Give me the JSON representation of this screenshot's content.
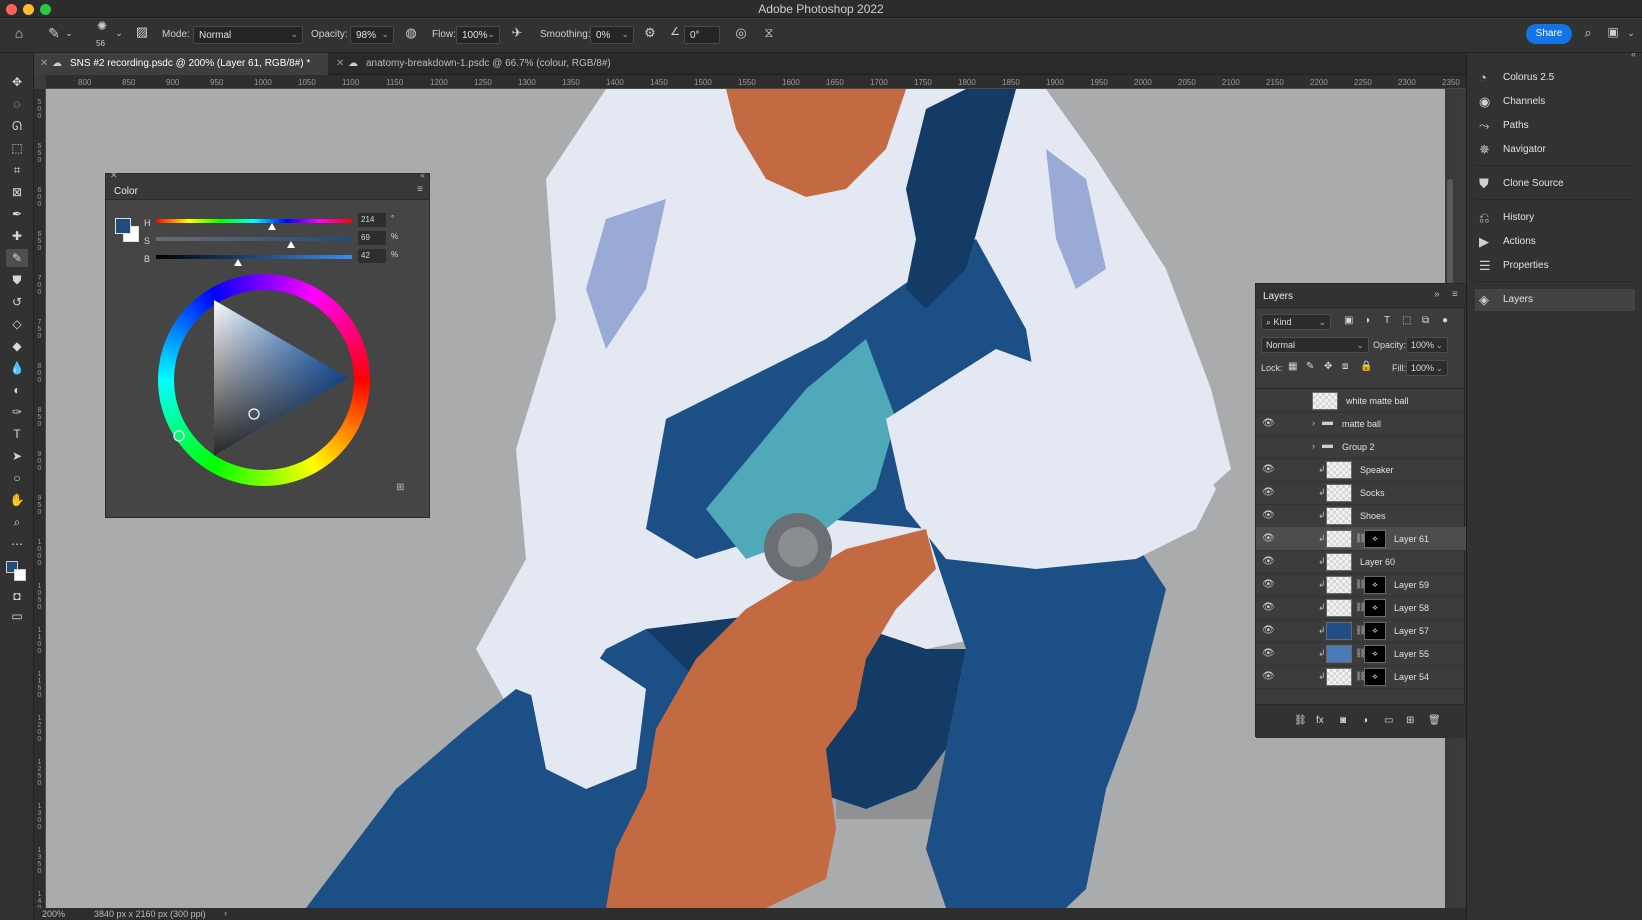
{
  "app": {
    "title": "Adobe Photoshop 2022"
  },
  "options": {
    "brush_size": "56",
    "mode_label": "Mode:",
    "mode_value": "Normal",
    "opacity_label": "Opacity:",
    "opacity_value": "98%",
    "flow_label": "Flow:",
    "flow_value": "100%",
    "smoothing_label": "Smoothing:",
    "smoothing_value": "0%",
    "angle_value": "0°",
    "share_label": "Share"
  },
  "tabs": [
    {
      "label": "SNS #2 recording.psdc @ 200% (Layer 61, RGB/8#) *",
      "active": true
    },
    {
      "label": "anatomy-breakdown-1.psdc @ 66.7% (colour, RGB/8#)",
      "active": false
    }
  ],
  "ruler": {
    "top_ticks": [
      "800",
      "850",
      "900",
      "950",
      "1000",
      "1050",
      "1100",
      "1150",
      "1200",
      "1250",
      "1300",
      "1350",
      "1400",
      "1450",
      "1500",
      "1550",
      "1600",
      "1650",
      "1700",
      "1750",
      "1800",
      "1850",
      "1900",
      "1950",
      "2000",
      "2050",
      "2100",
      "2150",
      "2200",
      "2250",
      "2300",
      "2350"
    ],
    "left_ticks": [
      "500",
      "550",
      "600",
      "650",
      "700",
      "750",
      "800",
      "850",
      "900",
      "950",
      "1000",
      "1050",
      "1100",
      "1150",
      "1200",
      "1250",
      "1300",
      "1350",
      "1400"
    ]
  },
  "status": {
    "zoom": "200%",
    "doc_info": "3840 px x 2160 px (300 ppi)"
  },
  "color_panel": {
    "title": "Color",
    "h_label": "H",
    "h_value": "214",
    "h_unit": "°",
    "h_pos": 0.59,
    "s_label": "S",
    "s_value": "69",
    "s_unit": "%",
    "s_pos": 0.69,
    "b_label": "B",
    "b_value": "42",
    "b_unit": "%",
    "b_pos": 0.42,
    "foreground_color": "#214c7b",
    "background_color": "#ffffff"
  },
  "dock": {
    "items": [
      {
        "label": "Colorus 2.5",
        "icon": "colorus-icon"
      },
      {
        "label": "Channels",
        "icon": "channels-icon"
      },
      {
        "label": "Paths",
        "icon": "paths-icon"
      },
      {
        "label": "Navigator",
        "icon": "navigator-icon"
      },
      {
        "label": "Clone Source",
        "icon": "clone-source-icon"
      },
      {
        "label": "History",
        "icon": "history-icon"
      },
      {
        "label": "Actions",
        "icon": "actions-icon"
      },
      {
        "label": "Properties",
        "icon": "properties-icon"
      },
      {
        "label": "Layers",
        "icon": "layers-icon"
      }
    ]
  },
  "layers_panel": {
    "title": "Layers",
    "filter_kind": "Kind",
    "blend_mode": "Normal",
    "opacity_label": "Opacity:",
    "opacity_value": "100%",
    "lock_label": "Lock:",
    "fill_label": "Fill:",
    "fill_value": "100%",
    "layers": [
      {
        "name": "white matte ball",
        "visible": false,
        "type": "layer"
      },
      {
        "name": "matte ball",
        "visible": true,
        "type": "group"
      },
      {
        "name": "Group 2",
        "visible": false,
        "type": "group"
      },
      {
        "name": "Speaker",
        "visible": true,
        "type": "clipped"
      },
      {
        "name": "Socks",
        "visible": true,
        "type": "clipped"
      },
      {
        "name": "Shoes",
        "visible": true,
        "type": "clipped"
      },
      {
        "name": "Layer 61",
        "visible": true,
        "type": "clipped-mask",
        "selected": true
      },
      {
        "name": "Layer 60",
        "visible": true,
        "type": "clipped"
      },
      {
        "name": "Layer 59",
        "visible": true,
        "type": "clipped-mask"
      },
      {
        "name": "Layer 58",
        "visible": true,
        "type": "clipped-mask"
      },
      {
        "name": "Layer 57",
        "visible": true,
        "type": "clipped-mask",
        "thumb": "#1f4f86"
      },
      {
        "name": "Layer 55",
        "visible": true,
        "type": "clipped-mask",
        "thumb": "#4a7ab8"
      },
      {
        "name": "Layer 54",
        "visible": true,
        "type": "clipped-mask"
      }
    ]
  },
  "colors": {
    "canvas_bg": "#a9abad",
    "shirt": "#e3e8f2",
    "shirt_shadow": "#9aaad6",
    "overalls": "#1d4f87",
    "overalls_dark": "#143a66",
    "undershirt": "#4fa9b9",
    "skin": "#c46a43",
    "watch": "#6b6e73"
  }
}
